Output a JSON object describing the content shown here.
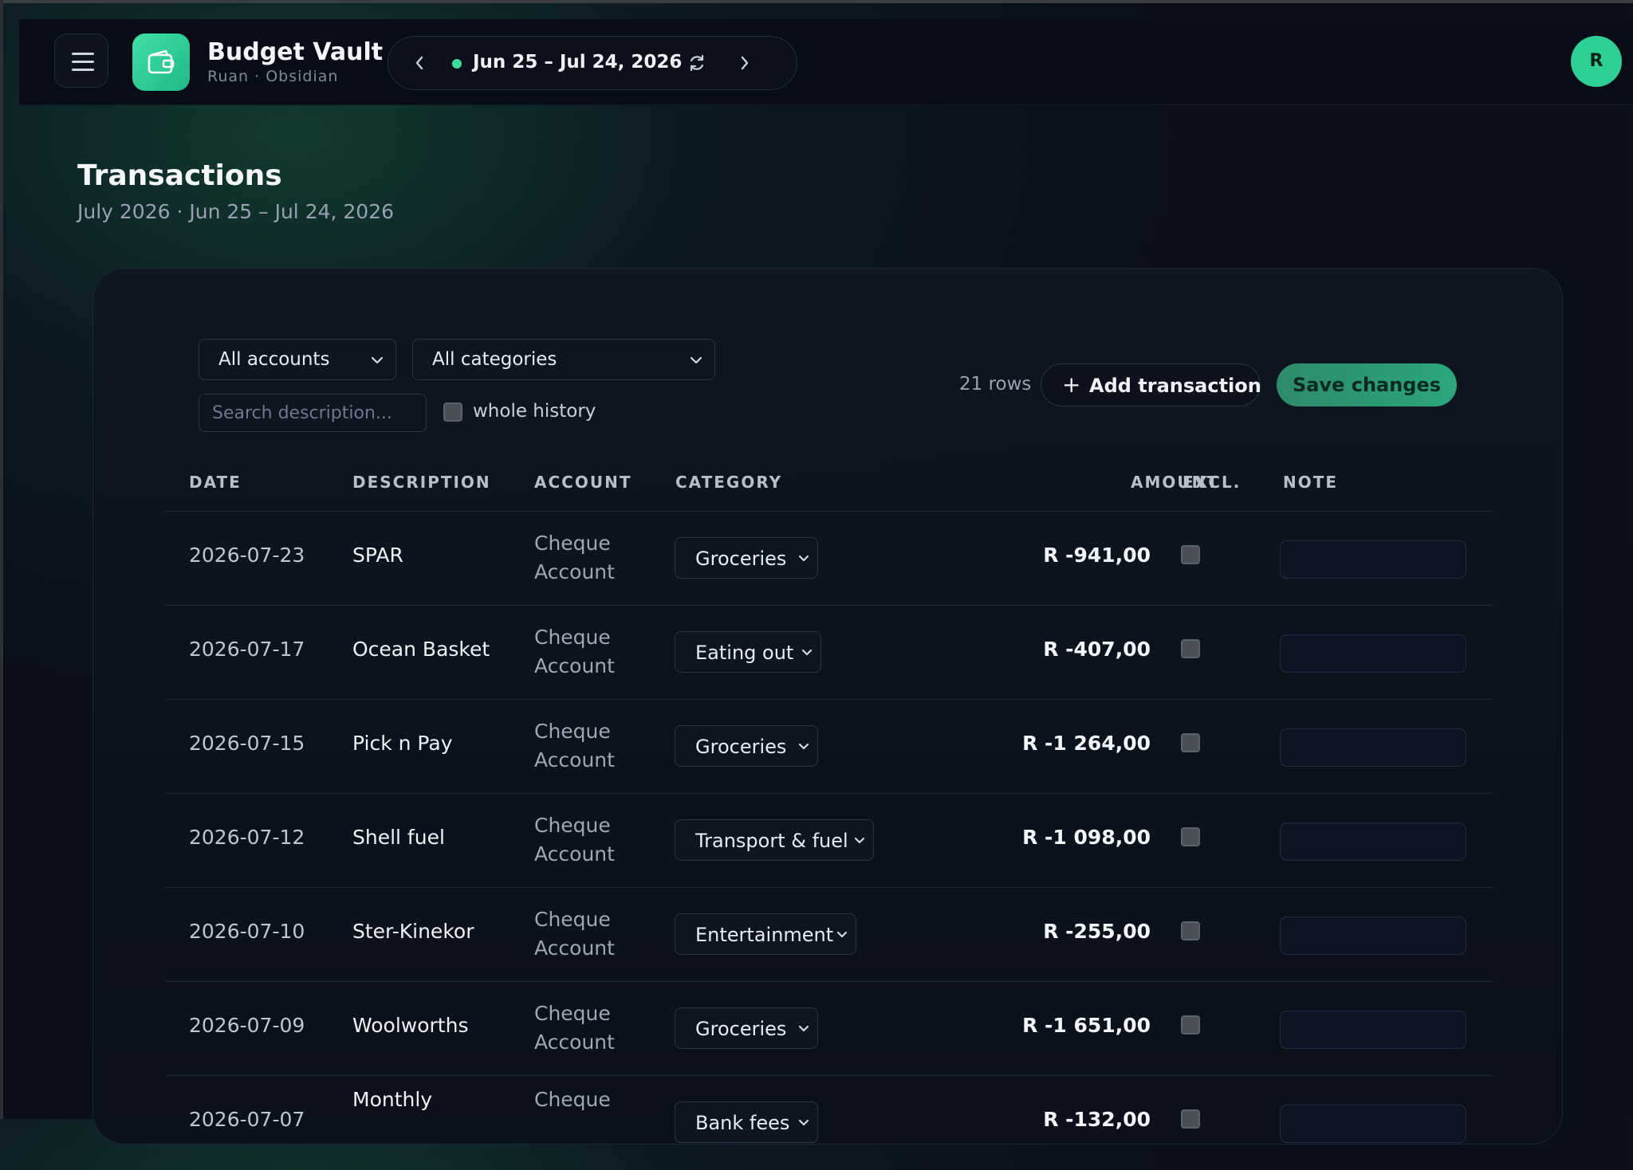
{
  "app": {
    "title": "Budget Vault",
    "subtitle": "Ruan · Obsidian",
    "avatar_initial": "R"
  },
  "period": {
    "label": "Jun 25 – Jul 24, 2026"
  },
  "page": {
    "title": "Transactions",
    "subtitle": "July 2026 · Jun 25 – Jul 24, 2026"
  },
  "filters": {
    "account": "All accounts",
    "category": "All categories",
    "search_placeholder": "Search description...",
    "whole_history_label": "whole history",
    "whole_history_checked": false
  },
  "toolbar": {
    "rows_count": "21 rows",
    "add_label": "Add transaction",
    "save_label": "Save changes"
  },
  "table": {
    "headers": [
      "DATE",
      "DESCRIPTION",
      "ACCOUNT",
      "CATEGORY",
      "AMOUNT",
      "EXCL.",
      "NOTE"
    ],
    "rows": [
      {
        "date": "2026-07-23",
        "description": "SPAR",
        "account": "Cheque Account",
        "category": "Groceries",
        "amount": "R -941,00",
        "excluded": false,
        "note": ""
      },
      {
        "date": "2026-07-17",
        "description": "Ocean Basket",
        "account": "Cheque Account",
        "category": "Eating out",
        "amount": "R -407,00",
        "excluded": false,
        "note": ""
      },
      {
        "date": "2026-07-15",
        "description": "Pick n Pay",
        "account": "Cheque Account",
        "category": "Groceries",
        "amount": "R -1 264,00",
        "excluded": false,
        "note": ""
      },
      {
        "date": "2026-07-12",
        "description": "Shell fuel",
        "account": "Cheque Account",
        "category": "Transport & fuel",
        "amount": "R -1 098,00",
        "excluded": false,
        "note": ""
      },
      {
        "date": "2026-07-10",
        "description": "Ster-Kinekor",
        "account": "Cheque Account",
        "category": "Entertainment",
        "amount": "R -255,00",
        "excluded": false,
        "note": ""
      },
      {
        "date": "2026-07-09",
        "description": "Woolworths",
        "account": "Cheque Account",
        "category": "Groceries",
        "amount": "R -1 651,00",
        "excluded": false,
        "note": ""
      },
      {
        "date": "2026-07-07",
        "description": "Monthly",
        "account": "Cheque",
        "category": "Bank fees",
        "amount": "R -132,00",
        "excluded": false,
        "note": ""
      }
    ]
  },
  "colors": {
    "accent": "#2ecf94",
    "background": "#0a0f1b"
  }
}
